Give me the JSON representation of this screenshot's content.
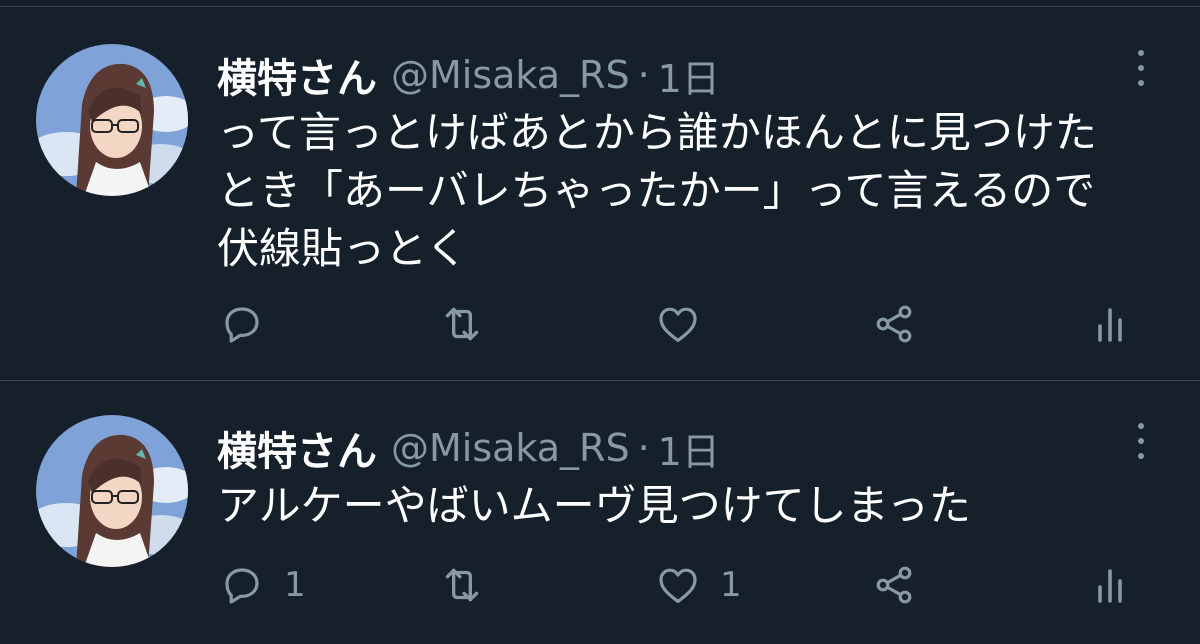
{
  "tweets": [
    {
      "name": "横特さん",
      "handle": "@Misaka_RS",
      "separator": "·",
      "time": "1日",
      "lines": [
        "って言っとけばあとから誰かほんとに見つけた",
        "とき「あーバレちゃったかー」って言えるので",
        "伏線貼っとく"
      ],
      "reply_count": "",
      "retweet_count": "",
      "like_count": ""
    },
    {
      "name": "横特さん",
      "handle": "@Misaka_RS",
      "separator": "·",
      "time": "1日",
      "lines": [
        "アルケーやばいムーヴ見つけてしまった"
      ],
      "reply_count": "1",
      "retweet_count": "",
      "like_count": "1"
    }
  ],
  "icons": {
    "more": "more-vertical-icon",
    "reply": "reply-bubble-icon",
    "retweet": "retweet-icon",
    "like": "heart-icon",
    "share": "share-icon",
    "analytics": "analytics-icon"
  },
  "colors": {
    "background": "#15202b",
    "divider": "#38444d",
    "primary_text": "#ffffff",
    "secondary_text": "#8899a6"
  }
}
